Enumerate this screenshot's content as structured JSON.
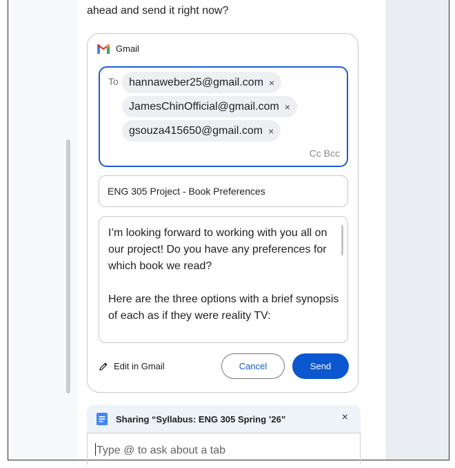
{
  "intro": "ahead and send it right now?",
  "gmail": {
    "app_name": "Gmail",
    "to_label": "To",
    "recipients": [
      "hannaweber25@gmail.com",
      "JamesChinOfficial@gmail.com",
      "gsouza415650@gmail.com"
    ],
    "remove_glyph": "×",
    "cc_bcc": "Cc Bcc",
    "subject": "ENG 305 Project - Book Preferences",
    "body": "I’m looking forward to working with you all on our project! Do you have any preferences for which book we read?\n\nHere are the three options with a brief synopsis of each as if they were reality TV:\n\n**Pride and Prejudice**",
    "edit_label": "Edit in Gmail",
    "cancel_label": "Cancel",
    "send_label": "Send"
  },
  "sharing": {
    "label": "Sharing “Syllabus: ENG 305 Spring ’26”",
    "close_glyph": "×"
  },
  "chat_input": {
    "placeholder": "Type @ to ask about a tab"
  },
  "colors": {
    "accent": "#0b57d0",
    "focus_border": "#1a5bd1",
    "chip_bg": "#eeeff2"
  }
}
